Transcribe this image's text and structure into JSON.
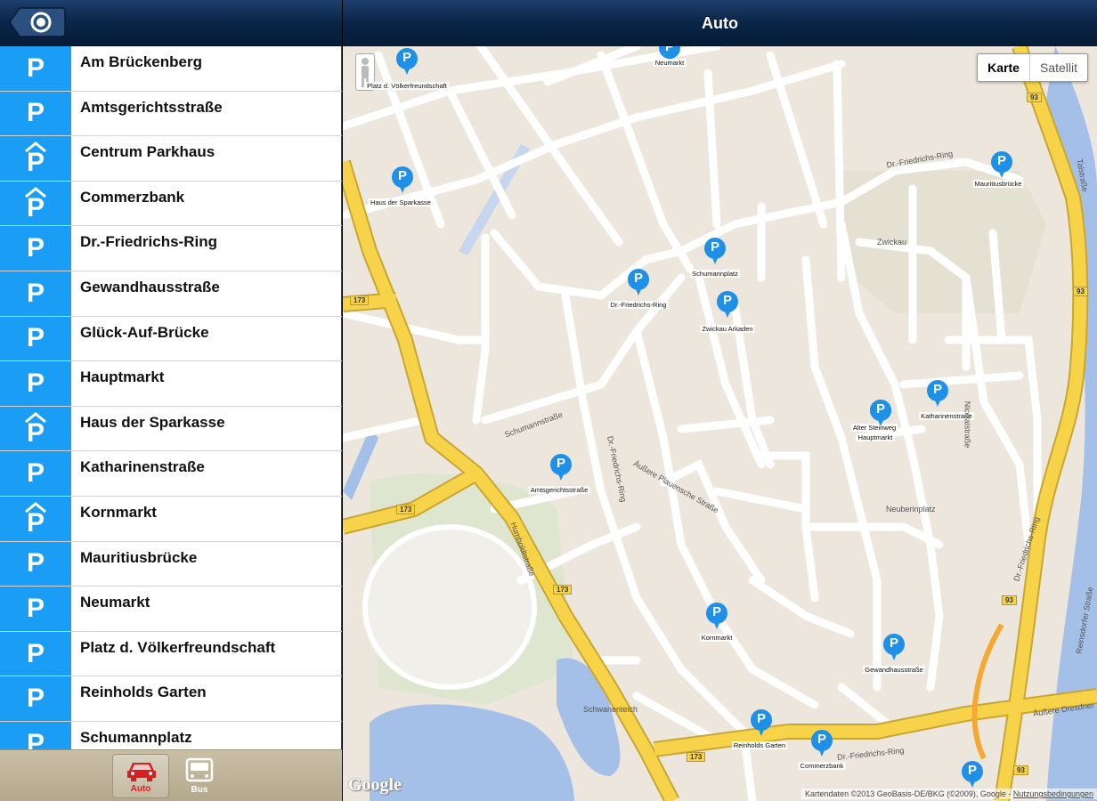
{
  "header": {
    "title": "Auto"
  },
  "parking_list": [
    {
      "label": "Am Brückenberg",
      "icon": "parking-icon"
    },
    {
      "label": "Amtsgerichtsstraße",
      "icon": "parking-icon"
    },
    {
      "label": "Centrum Parkhaus",
      "icon": "parking-garage-icon"
    },
    {
      "label": "Commerzbank",
      "icon": "parking-garage-icon"
    },
    {
      "label": "Dr.-Friedrichs-Ring",
      "icon": "parking-icon"
    },
    {
      "label": "Gewandhausstraße",
      "icon": "parking-icon"
    },
    {
      "label": "Glück-Auf-Brücke",
      "icon": "parking-icon"
    },
    {
      "label": "Hauptmarkt",
      "icon": "parking-icon"
    },
    {
      "label": "Haus der Sparkasse",
      "icon": "parking-garage-icon"
    },
    {
      "label": "Katharinenstraße",
      "icon": "parking-icon"
    },
    {
      "label": "Kornmarkt",
      "icon": "parking-garage-icon"
    },
    {
      "label": "Mauritiusbrücke",
      "icon": "parking-icon"
    },
    {
      "label": "Neumarkt",
      "icon": "parking-icon"
    },
    {
      "label": "Platz d. Völkerfreundschaft",
      "icon": "parking-icon"
    },
    {
      "label": "Reinholds Garten",
      "icon": "parking-icon"
    },
    {
      "label": "Schumannplatz",
      "icon": "parking-icon"
    }
  ],
  "tabs": [
    {
      "label": "Auto",
      "icon": "car-icon",
      "active": true
    },
    {
      "label": "Bus",
      "icon": "bus-icon",
      "active": false
    }
  ],
  "map": {
    "toggle": {
      "map_label": "Karte",
      "satellite_label": "Satellit"
    },
    "pin_letter": "P",
    "pins": [
      {
        "label": "Platz d. Völkerfreundschaft"
      },
      {
        "label": "Neumarkt"
      },
      {
        "label": "Haus der Sparkasse"
      },
      {
        "label": "Mauritiusbrücke"
      },
      {
        "label": "Schumannplatz"
      },
      {
        "label": "Dr.-Friedrichs-Ring"
      },
      {
        "label": "Zwickau Arkaden"
      },
      {
        "label": "Katharinenstraße"
      },
      {
        "label": "Alter Steinweg"
      },
      {
        "label": "Hauptmarkt"
      },
      {
        "label": "Amtsgerichtsstraße"
      },
      {
        "label": "Kornmarkt"
      },
      {
        "label": "Gewandhausstraße"
      },
      {
        "label": "Reinholds Garten"
      },
      {
        "label": "Commerzbank"
      },
      {
        "label": ""
      }
    ],
    "street_labels": [
      "Dr.-Friedrichs-Ring",
      "Dr.-Friedrichs-Ring",
      "Dr.-Friedrichs-Ring",
      "Dr.-Friedrichs-Ring",
      "Humboldtstraße",
      "Schumannstraße",
      "Äußere Dresdner",
      "Neuberinplatz",
      "Nicolaistraße",
      "Zwickau",
      "Schwanenteich",
      "Reinsdorfer Straße",
      "Talstraße",
      "Äußere Plauensche Straße"
    ],
    "road_numbers": [
      "93",
      "93",
      "93",
      "93",
      "173",
      "173",
      "173",
      "173"
    ],
    "brand": "Google",
    "credits_text": "Kartendaten ©2013 GeoBasis-DE/BKG (©2009), Google - ",
    "credits_link": "Nutzungsbedingungen"
  },
  "colors": {
    "header_bg": "#0a2547",
    "list_icon_bg": "#1a9ef5",
    "pin_blue": "#1e90e8",
    "map_land": "#ece6dc",
    "major_road": "#f7d34a",
    "water": "#a5c0e8",
    "tab_active_text": "#d42020"
  }
}
